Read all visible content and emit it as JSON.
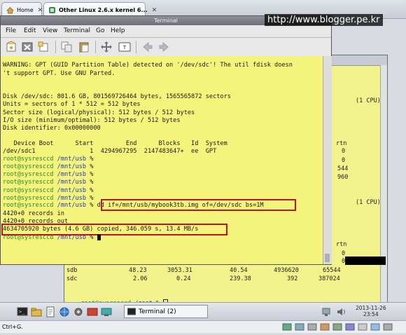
{
  "browser": {
    "tabs": [
      {
        "label": "Home",
        "icon": "home-icon"
      },
      {
        "label": "Other Linux 2.6.x kernel 6...",
        "icon": "vm-icon"
      }
    ],
    "watermark": "http://www.blogger.pe.kr"
  },
  "window": {
    "title": "Terminal",
    "menu": [
      "File",
      "Edit",
      "View",
      "Terminal",
      "Go",
      "Help"
    ]
  },
  "toolbar": {
    "icons": [
      "new-tab-icon",
      "close-tab-icon",
      "new-window-icon",
      "copy-icon",
      "paste-icon",
      "fullscreen-icon",
      "zoom-icon",
      "back-icon",
      "forward-icon"
    ]
  },
  "terminal": {
    "lines": [
      {
        "text": "WARNING: GPT (GUID Partition Table) detected on '/dev/sdc'! The util fdisk doesn"
      },
      {
        "text": "'t support GPT. Use GNU Parted."
      },
      {
        "text": ""
      },
      {
        "text": "Disk /dev/sdc: 801.6 GB, 801569726464 bytes, 1565565872 sectors"
      },
      {
        "text": "Units = sectors of 1 * 512 = 512 bytes"
      },
      {
        "text": "Sector size (logical/physical): 512 bytes / 512 bytes"
      },
      {
        "text": "I/O size (minimum/optimal): 512 bytes / 512 bytes"
      },
      {
        "text": "Disk identifier: 0x00000000"
      },
      {
        "text": ""
      },
      {
        "text": "   Device Boot      Start         End      Blocks   Id  System"
      },
      {
        "text": "/dev/sdc1               1  4294967295  2147483647+  ee  GPT"
      }
    ],
    "prompt_user": "root@sysresccd",
    "prompt_path": "/mnt/usb",
    "prompt_sym": "%",
    "empty_prompts": 5,
    "command": "dd if=/mnt/usb/mybook3tb.img of=/dev/sdc bs=1M",
    "records_in": "4420+0 records in",
    "records_out": "4420+0 records out",
    "result": "4634705920 bytes (4.6 GB) copied, 346.059 s, 13.4 MB/s"
  },
  "background_terminal": {
    "cpu_label_1": "(1 CPU)",
    "cpu_label_2": "(1 CPU)",
    "col_header": "rtn",
    "right_values": [
      "0",
      "0",
      "544",
      "960"
    ],
    "right_values_2": [
      "rtn",
      "0",
      "0"
    ],
    "rows": [
      {
        "dev": "sdb",
        "c1": "48.23",
        "c2": "3053.31",
        "c3": "40.54",
        "c4": "4936620",
        "c5": "65544"
      },
      {
        "dev": "sdc",
        "c1": "2.06",
        "c2": "0.24",
        "c3": "239.38",
        "c4": "392",
        "c5": "387024"
      }
    ],
    "prompt_user": "root@sysresccd",
    "prompt_path": "/root",
    "prompt_sym": "%"
  },
  "taskbar": {
    "task_label": "Terminal (2)",
    "date": "2013-11-26",
    "time": "23:54"
  },
  "statusbar": {
    "hint": "Ctrl+G."
  }
}
